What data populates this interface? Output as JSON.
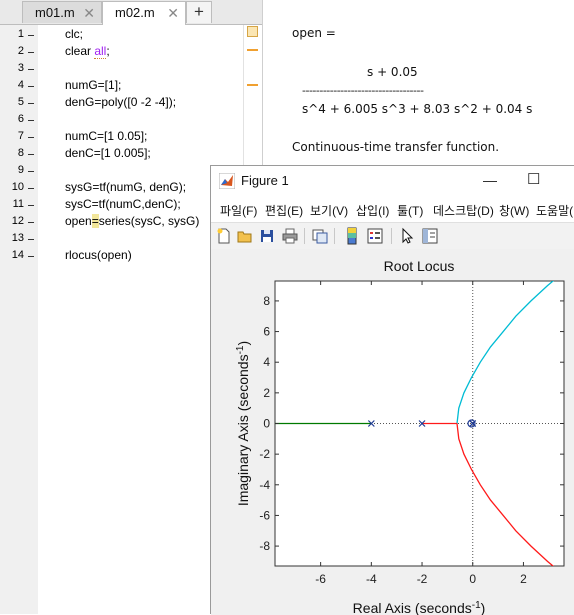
{
  "editor": {
    "tabs": [
      {
        "label": "m01.m",
        "close": "✕"
      },
      {
        "label": "m02.m",
        "close": "✕"
      }
    ],
    "add_tab": "+",
    "lines": [
      {
        "num": "1",
        "text": "clc;"
      },
      {
        "num": "2",
        "text_pre": "clear ",
        "text_kw": "all",
        "text_post": ";"
      },
      {
        "num": "3",
        "text": ""
      },
      {
        "num": "4",
        "text": "numG=[1];"
      },
      {
        "num": "5",
        "text": "denG=poly([0 -2 -4]);"
      },
      {
        "num": "6",
        "text": ""
      },
      {
        "num": "7",
        "text": "numC=[1 0.05];"
      },
      {
        "num": "8",
        "text": "denC=[1 0.005];"
      },
      {
        "num": "9",
        "text": ""
      },
      {
        "num": "10",
        "text": "sysG=tf(numG, denG);"
      },
      {
        "num": "11",
        "text": "sysC=tf(numC,denC);"
      },
      {
        "num": "12",
        "text_pre": "open",
        "text_hl": "=",
        "text_post": "series(sysC, sysG)"
      },
      {
        "num": "13",
        "text": ""
      },
      {
        "num": "14",
        "text": "rlocus(open)"
      }
    ]
  },
  "command_window": {
    "var_line": "open =",
    "numerator": "s + 0.05",
    "divider": "-----------------------------------",
    "denominator": "s^4 + 6.005 s^3 + 8.03 s^2 + 0.04 s",
    "description": "Continuous-time transfer function."
  },
  "figure": {
    "title": "Figure 1",
    "minimize": "—",
    "maximize": "☐",
    "menu": [
      "파일(F)",
      "편집(E)",
      "보기(V)",
      "삽입(I)",
      "툴(T)",
      "데스크탑(D)",
      "창(W)",
      "도움말(H)"
    ],
    "toolbar_icons": [
      "new-figure-icon",
      "open-file-icon",
      "save-icon",
      "print-icon",
      "link-plot-icon",
      "colorbar-icon",
      "legend-icon",
      "pointer-icon",
      "property-editor-icon"
    ]
  },
  "chart_data": {
    "type": "line",
    "title": "Root Locus",
    "xlabel": "Real Axis (seconds",
    "xlabel_sup": "-1",
    "xlabel_end": ")",
    "ylabel": "Imaginary Axis (seconds",
    "ylabel_sup": "-1",
    "ylabel_end": ")",
    "xlim": [
      -7.8,
      3.6
    ],
    "ylim": [
      -9.3,
      9.3
    ],
    "xticks": [
      -6,
      -4,
      -2,
      0,
      2
    ],
    "yticks": [
      -8,
      -6,
      -4,
      -2,
      0,
      2,
      4,
      6,
      8
    ],
    "poles": [
      0,
      -0.005,
      -2,
      -4
    ],
    "zeros": [
      -0.05
    ],
    "series": [
      {
        "color": "#00bcd4",
        "points": [
          [
            -0.62,
            0
          ],
          [
            -0.55,
            1
          ],
          [
            -0.35,
            2
          ],
          [
            -0.05,
            3
          ],
          [
            0.3,
            4
          ],
          [
            0.7,
            5
          ],
          [
            1.2,
            6
          ],
          [
            1.7,
            7
          ],
          [
            2.3,
            8
          ],
          [
            2.95,
            9
          ],
          [
            3.6,
            9.9
          ]
        ]
      },
      {
        "color": "#ff1a1a",
        "points": [
          [
            -0.62,
            0
          ],
          [
            -0.55,
            -1
          ],
          [
            -0.35,
            -2
          ],
          [
            -0.05,
            -3
          ],
          [
            0.3,
            -4
          ],
          [
            0.7,
            -5
          ],
          [
            1.2,
            -6
          ],
          [
            1.7,
            -7
          ],
          [
            2.3,
            -8
          ],
          [
            2.95,
            -9
          ],
          [
            3.6,
            -9.9
          ]
        ]
      },
      {
        "color": "#ff1a1a",
        "points": [
          [
            -2,
            0
          ],
          [
            -0.62,
            0
          ]
        ]
      },
      {
        "color": "#007a00",
        "points": [
          [
            -4,
            0
          ],
          [
            -7.8,
            0
          ]
        ]
      },
      {
        "color": "#1f3a93",
        "points": [
          [
            -0.005,
            0
          ],
          [
            -0.05,
            0
          ]
        ]
      }
    ]
  }
}
